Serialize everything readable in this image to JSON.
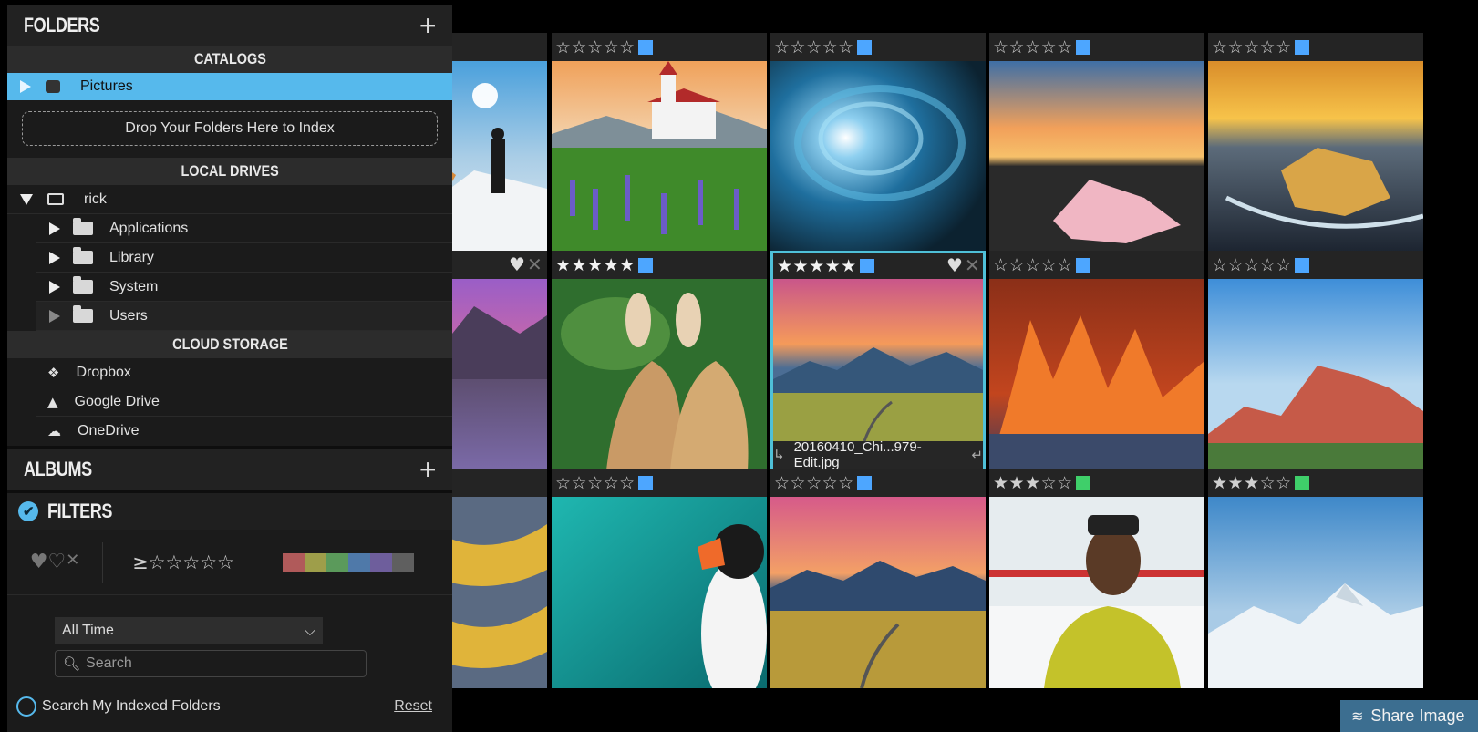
{
  "folders": {
    "title": "FOLDERS",
    "catalogs_header": "CATALOGS",
    "catalog_item": "Pictures",
    "drop_zone": "Drop Your Folders Here to Index",
    "local_drives_header": "LOCAL DRIVES",
    "drive": "rick",
    "drive_items": [
      "Applications",
      "Library",
      "System",
      "Users"
    ],
    "cloud_header": "CLOUD STORAGE",
    "cloud_items": [
      "Dropbox",
      "Google Drive",
      "OneDrive"
    ]
  },
  "albums": {
    "title": "ALBUMS"
  },
  "filters": {
    "title": "FILTERS",
    "rating_prefix": "≥☆☆☆☆☆",
    "time_select": "All Time",
    "search_placeholder": "Search",
    "indexed_label": "Search My Indexed Folders",
    "reset": "Reset",
    "color_swatches": [
      "#b05a5a",
      "#9e9e4a",
      "#5b9a5b",
      "#4f79a9",
      "#6e5e9c",
      "#5f5f5f"
    ]
  },
  "grid": {
    "selected_filename": "20160410_Chi...979-Edit.jpg",
    "tiles": [
      {
        "row": 0,
        "col": 0,
        "stars": 0,
        "label": null
      },
      {
        "row": 0,
        "col": 1,
        "stars": 0,
        "label": "#4da6ff"
      },
      {
        "row": 0,
        "col": 2,
        "stars": 0,
        "label": "#4da6ff"
      },
      {
        "row": 0,
        "col": 3,
        "stars": 0,
        "label": "#4da6ff"
      },
      {
        "row": 0,
        "col": 4,
        "stars": 0,
        "label": "#4da6ff"
      },
      {
        "row": 1,
        "col": 0,
        "stars": 0,
        "label": null
      },
      {
        "row": 1,
        "col": 1,
        "stars": 5,
        "label": "#4da6ff"
      },
      {
        "row": 1,
        "col": 2,
        "stars": 5,
        "label": "#4da6ff"
      },
      {
        "row": 1,
        "col": 3,
        "stars": 0,
        "label": "#4da6ff"
      },
      {
        "row": 1,
        "col": 4,
        "stars": 0,
        "label": "#4da6ff"
      },
      {
        "row": 2,
        "col": 0,
        "stars": 0,
        "label": null
      },
      {
        "row": 2,
        "col": 1,
        "stars": 0,
        "label": "#4da6ff"
      },
      {
        "row": 2,
        "col": 2,
        "stars": 0,
        "label": "#4da6ff"
      },
      {
        "row": 2,
        "col": 3,
        "stars": 3,
        "label": "#3fcf6a"
      },
      {
        "row": 2,
        "col": 4,
        "stars": 3,
        "label": "#3fcf6a"
      }
    ]
  },
  "share_button": "Share Image"
}
